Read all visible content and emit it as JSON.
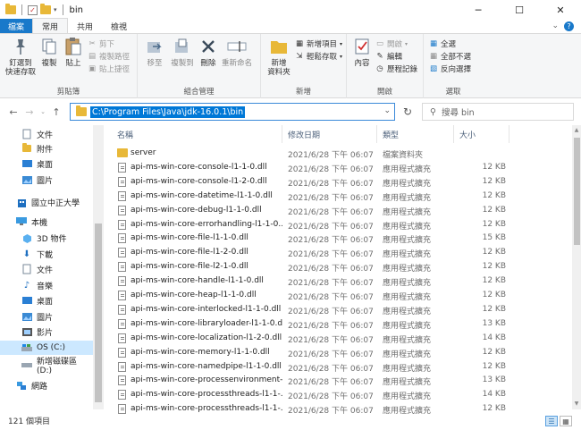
{
  "window": {
    "title": "bin",
    "controls": {
      "minimize": "─",
      "maximize": "☐",
      "close": "✕"
    }
  },
  "ribbon_tabs": [
    {
      "label": "檔案"
    },
    {
      "label": "常用"
    },
    {
      "label": "共用"
    },
    {
      "label": "檢視"
    }
  ],
  "ribbon": {
    "clipboard": {
      "label": "剪貼簿",
      "pin": "釘選到\n快速存取",
      "copy": "複製",
      "paste": "貼上",
      "cut": "剪下",
      "copy_path": "複製路徑",
      "paste_shortcut": "貼上捷徑"
    },
    "organize": {
      "label": "組合管理",
      "move_to": "移至",
      "copy_to": "複製到",
      "delete": "刪除",
      "rename": "重新命名"
    },
    "new": {
      "label": "新增",
      "new_folder": "新增\n資料夾",
      "new_item": "新增項目",
      "easy_access": "輕鬆存取"
    },
    "open": {
      "label": "開啟",
      "properties": "內容",
      "open": "開啟",
      "edit": "編輯",
      "history": "歷程記錄"
    },
    "select": {
      "label": "選取",
      "select_all": "全選",
      "select_none": "全部不選",
      "invert": "反向選擇"
    }
  },
  "address": {
    "path": "C:\\Program Files\\Java\\jdk-16.0.1\\bin",
    "search_placeholder": "搜尋 bin"
  },
  "nav_pane": [
    {
      "label": "文件",
      "icon": "document-icon"
    },
    {
      "label": "附件",
      "icon": "folder-icon"
    },
    {
      "label": "桌面",
      "icon": "desktop-icon"
    },
    {
      "label": "圖片",
      "icon": "pictures-icon"
    },
    {
      "label": "國立中正大學",
      "icon": "building-icon"
    },
    {
      "label": "本機",
      "icon": "computer-icon"
    },
    {
      "label": "3D 物件",
      "icon": "3d-objects-icon"
    },
    {
      "label": "下載",
      "icon": "download-icon"
    },
    {
      "label": "文件",
      "icon": "document-icon"
    },
    {
      "label": "音樂",
      "icon": "music-icon"
    },
    {
      "label": "桌面",
      "icon": "desktop-icon"
    },
    {
      "label": "圖片",
      "icon": "pictures-icon"
    },
    {
      "label": "影片",
      "icon": "videos-icon"
    },
    {
      "label": "OS (C:)",
      "icon": "drive-icon"
    },
    {
      "label": "新增磁碟區 (D:)",
      "icon": "drive-icon"
    },
    {
      "label": "網路",
      "icon": "network-icon"
    }
  ],
  "columns": {
    "name": "名稱",
    "date": "修改日期",
    "type": "類型",
    "size": "大小"
  },
  "files": [
    {
      "name": "server",
      "date": "2021/6/28 下午 06:07",
      "type": "檔案資料夾",
      "size": "",
      "folder": true
    },
    {
      "name": "api-ms-win-core-console-l1-1-0.dll",
      "date": "2021/6/28 下午 06:07",
      "type": "應用程式擴充",
      "size": "12 KB"
    },
    {
      "name": "api-ms-win-core-console-l1-2-0.dll",
      "date": "2021/6/28 下午 06:07",
      "type": "應用程式擴充",
      "size": "12 KB"
    },
    {
      "name": "api-ms-win-core-datetime-l1-1-0.dll",
      "date": "2021/6/28 下午 06:07",
      "type": "應用程式擴充",
      "size": "12 KB"
    },
    {
      "name": "api-ms-win-core-debug-l1-1-0.dll",
      "date": "2021/6/28 下午 06:07",
      "type": "應用程式擴充",
      "size": "12 KB"
    },
    {
      "name": "api-ms-win-core-errorhandling-l1-1-0...",
      "date": "2021/6/28 下午 06:07",
      "type": "應用程式擴充",
      "size": "12 KB"
    },
    {
      "name": "api-ms-win-core-file-l1-1-0.dll",
      "date": "2021/6/28 下午 06:07",
      "type": "應用程式擴充",
      "size": "15 KB"
    },
    {
      "name": "api-ms-win-core-file-l1-2-0.dll",
      "date": "2021/6/28 下午 06:07",
      "type": "應用程式擴充",
      "size": "12 KB"
    },
    {
      "name": "api-ms-win-core-file-l2-1-0.dll",
      "date": "2021/6/28 下午 06:07",
      "type": "應用程式擴充",
      "size": "12 KB"
    },
    {
      "name": "api-ms-win-core-handle-l1-1-0.dll",
      "date": "2021/6/28 下午 06:07",
      "type": "應用程式擴充",
      "size": "12 KB"
    },
    {
      "name": "api-ms-win-core-heap-l1-1-0.dll",
      "date": "2021/6/28 下午 06:07",
      "type": "應用程式擴充",
      "size": "12 KB"
    },
    {
      "name": "api-ms-win-core-interlocked-l1-1-0.dll",
      "date": "2021/6/28 下午 06:07",
      "type": "應用程式擴充",
      "size": "12 KB"
    },
    {
      "name": "api-ms-win-core-libraryloader-l1-1-0.dll",
      "date": "2021/6/28 下午 06:07",
      "type": "應用程式擴充",
      "size": "13 KB"
    },
    {
      "name": "api-ms-win-core-localization-l1-2-0.dll",
      "date": "2021/6/28 下午 06:07",
      "type": "應用程式擴充",
      "size": "14 KB"
    },
    {
      "name": "api-ms-win-core-memory-l1-1-0.dll",
      "date": "2021/6/28 下午 06:07",
      "type": "應用程式擴充",
      "size": "12 KB"
    },
    {
      "name": "api-ms-win-core-namedpipe-l1-1-0.dll",
      "date": "2021/6/28 下午 06:07",
      "type": "應用程式擴充",
      "size": "12 KB"
    },
    {
      "name": "api-ms-win-core-processenvironment-l...",
      "date": "2021/6/28 下午 06:07",
      "type": "應用程式擴充",
      "size": "13 KB"
    },
    {
      "name": "api-ms-win-core-processthreads-l1-1-...",
      "date": "2021/6/28 下午 06:07",
      "type": "應用程式擴充",
      "size": "14 KB"
    },
    {
      "name": "api-ms-win-core-processthreads-l1-1-...",
      "date": "2021/6/28 下午 06:07",
      "type": "應用程式擴充",
      "size": "12 KB"
    }
  ],
  "status": {
    "item_count": "121 個項目"
  },
  "colors": {
    "accent": "#1979ca",
    "selection": "#0078d7",
    "folder": "#e8b838"
  }
}
